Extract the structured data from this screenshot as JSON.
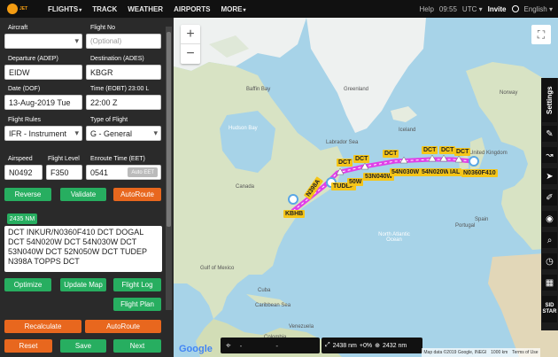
{
  "nav": {
    "logo_text": "JET",
    "items": [
      {
        "label": "FLIGHTS",
        "caret": "▾"
      },
      {
        "label": "TRACK"
      },
      {
        "label": "WEATHER"
      },
      {
        "label": "AIRPORTS"
      },
      {
        "label": "MORE",
        "caret": "▾"
      }
    ],
    "help": "Help",
    "time": "09:55",
    "utc": "UTC ▾",
    "invite": "Invite",
    "language": "English ▾"
  },
  "form": {
    "aircraft_label": "Aircraft",
    "aircraft_value": "",
    "flightno_label": "Flight No",
    "flightno_placeholder": "(Optional)",
    "departure_label": "Departure (ADEP)",
    "departure_value": "EIDW",
    "destination_label": "Destination (ADES)",
    "destination_value": "KBGR",
    "date_label": "Date (DOF)",
    "date_value": "13-Aug-2019 Tue",
    "time_label": "Time (EOBT) 23:00 L",
    "time_value": "22:00 Z",
    "rules_label": "Flight Rules",
    "rules_value": "IFR - Instrument",
    "type_label": "Type of Flight",
    "type_value": "G - General",
    "airspeed_label": "Airspeed",
    "airspeed_value": "N0492",
    "level_label": "Flight Level",
    "level_value": "F350",
    "eet_label": "Enroute Time (EET)",
    "eet_value": "0541",
    "auto_eet": "Auto EET"
  },
  "buttons": {
    "reverse": "Reverse",
    "validate": "Validate",
    "autoroute": "AutoRoute",
    "optimize": "Optimize",
    "update_map": "Update Map",
    "flight_log": "Flight Log",
    "flight_plan": "Flight Plan",
    "recalculate": "Recalculate",
    "autoroute2": "AutoRoute",
    "reset": "Reset",
    "save": "Save",
    "next": "Next"
  },
  "route": {
    "distance_badge": "2435 NM",
    "text": "DCT INKUR/N0360F410 DCT DOGAL DCT 54N020W DCT 54N030W DCT 53N040W DCT 52N050W DCT TUDEP N398A TOPPS DCT"
  },
  "map": {
    "zoom_in": "+",
    "zoom_out": "−",
    "fullscreen": "⛶",
    "labels": {
      "greenland": "Greenland",
      "baffin": "Baffin Bay",
      "hudson": "Hudson Bay",
      "labrador": "Labrador Sea",
      "atlantic": "North Atlantic Ocean",
      "iceland": "Iceland",
      "norway": "Norway",
      "uk": "United Kingdom",
      "spain": "Spain",
      "portugal": "Portugal",
      "gulf": "Gulf of Mexico",
      "caribbean": "Caribbean Sea",
      "colombia": "Colombia",
      "venezuela": "Venezuela",
      "cuba": "Cuba",
      "canada": "Canada"
    },
    "waypoints": [
      {
        "label": "DCT"
      },
      {
        "label": "DCT"
      },
      {
        "label": "DCT"
      },
      {
        "label": "DCT"
      },
      {
        "label": "DCT"
      },
      {
        "label": "DCT"
      },
      {
        "label": "N398A"
      },
      {
        "label": "KBHB"
      },
      {
        "label": "TUDEP"
      },
      {
        "label": "50W"
      },
      {
        "label": "53N040W"
      },
      {
        "label": "54N030W"
      },
      {
        "label": "54N020W"
      },
      {
        "label": "IAL"
      },
      {
        "label": "N0360F410"
      }
    ],
    "google": "Google",
    "attribution": [
      "Map data ©2019 Google, INEGI",
      "1000 km",
      "Terms of Use"
    ]
  },
  "tools": {
    "settings": "Settings",
    "sid_star": "SID STAR"
  },
  "status": {
    "coords": "-",
    "coords2": "-",
    "distance": "2438 nm",
    "pct": "+0%",
    "dist2": "2432 nm"
  },
  "colors": {
    "route": "#e040e8",
    "accent_green": "#27ae60",
    "accent_orange": "#e8671e",
    "waypoint_label": "#f5c518"
  }
}
